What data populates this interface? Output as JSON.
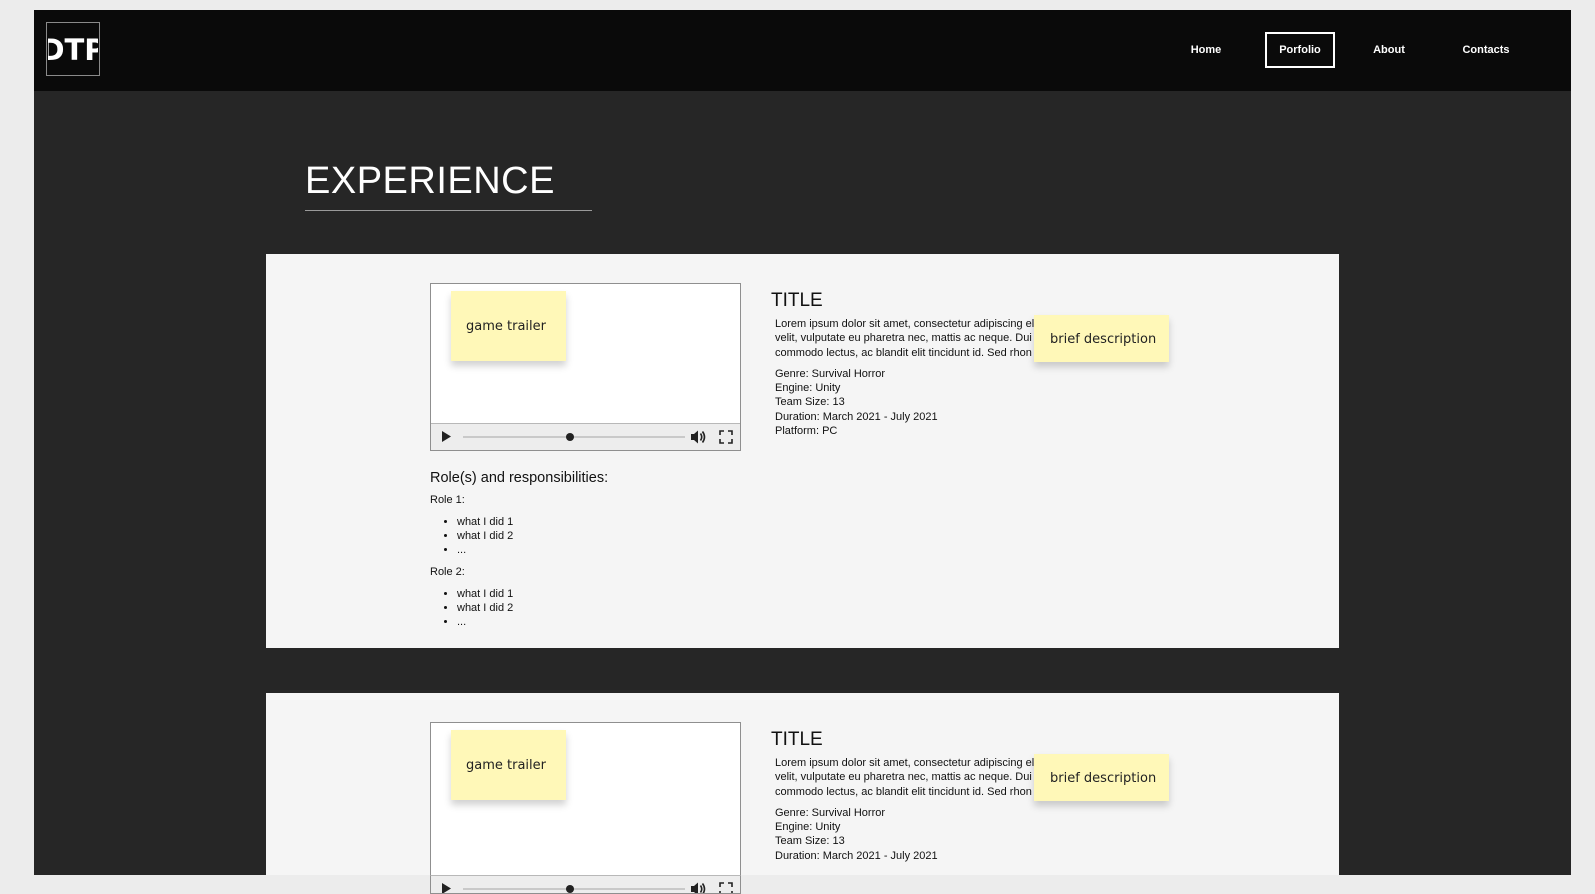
{
  "header": {
    "logo_text": "DTP",
    "nav": [
      {
        "label": "Home",
        "active": false
      },
      {
        "label": "Porfolio",
        "active": true
      },
      {
        "label": "About",
        "active": false
      },
      {
        "label": "Contacts",
        "active": false
      }
    ]
  },
  "page": {
    "section_title": "EXPERIENCE"
  },
  "colors": {
    "frame_bg": "#262626",
    "topbar_bg": "#0a0a0a",
    "card_bg": "#f5f5f5",
    "sticky_note": "#fff8b8"
  },
  "cards": [
    {
      "trailer_note": "game trailer",
      "video_progress": 0.48,
      "title": "TITLE",
      "lorem_lines": [
        "Lorem ipsum dolor sit amet, consectetur adipiscing el",
        "velit, vulputate eu pharetra nec, mattis ac neque. Dui",
        "commodo lectus, ac blandit elit tincidunt id. Sed rhon"
      ],
      "description_note": "brief description",
      "meta": [
        "Genre: Survival Horror",
        "Engine: Unity",
        "Team Size: 13",
        "Duration: March 2021 - July 2021",
        "Platform: PC"
      ],
      "roles_heading": "Role(s) and responsibilities:",
      "roles": [
        {
          "label": "Role 1:",
          "items": [
            "what I did 1",
            "what I did 2",
            "..."
          ]
        },
        {
          "label": "Role 2:",
          "items": [
            "what I did 1",
            "what I did 2",
            "..."
          ]
        }
      ]
    },
    {
      "trailer_note": "game trailer",
      "video_progress": 0.48,
      "title": "TITLE",
      "lorem_lines": [
        "Lorem ipsum dolor sit amet, consectetur adipiscing el",
        "velit, vulputate eu pharetra nec, mattis ac neque. Dui",
        "commodo lectus, ac blandit elit tincidunt id. Sed rhon"
      ],
      "description_note": "brief description",
      "meta": [
        "Genre: Survival Horror",
        "Engine: Unity",
        "Team Size: 13",
        "Duration: March 2021 - July 2021"
      ]
    }
  ]
}
